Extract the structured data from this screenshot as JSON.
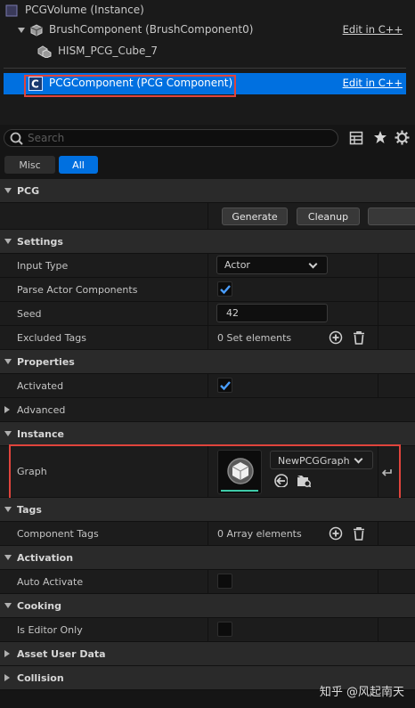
{
  "tree": {
    "items": [
      {
        "label": "PCGVolume (Instance)"
      },
      {
        "label": "BrushComponent (BrushComponent0)",
        "edit": "Edit in C++"
      },
      {
        "label": "HISM_PCG_Cube_7"
      },
      {
        "label": "PCGComponent (PCG Component)",
        "edit": "Edit in C++"
      }
    ]
  },
  "search": {
    "placeholder": "Search"
  },
  "filters": {
    "misc": "Misc",
    "all": "All"
  },
  "sections": {
    "pcg": "PCG",
    "settings": "Settings",
    "properties": "Properties",
    "instance": "Instance",
    "tags": "Tags",
    "activation": "Activation",
    "cooking": "Cooking",
    "asset_user_data": "Asset User Data",
    "collision": "Collision"
  },
  "pcg": {
    "generate": "Generate",
    "cleanup": "Cleanup"
  },
  "settings": {
    "input_type_label": "Input Type",
    "input_type_value": "Actor",
    "parse_label": "Parse Actor Components",
    "seed_label": "Seed",
    "seed_value": "42",
    "excluded_label": "Excluded Tags",
    "excluded_value": "0 Set elements"
  },
  "properties": {
    "activated_label": "Activated",
    "advanced_label": "Advanced"
  },
  "instance": {
    "graph_label": "Graph",
    "graph_value": "NewPCGGraph"
  },
  "tags": {
    "component_tags_label": "Component Tags",
    "component_tags_value": "0 Array elements"
  },
  "activation": {
    "auto_activate_label": "Auto Activate"
  },
  "cooking": {
    "editor_only_label": "Is Editor Only"
  },
  "watermark": "知乎 @风起南天",
  "colors": {
    "selection": "#0070e0",
    "highlight_box": "#e0443c",
    "checkbox_tick": "#4a9eff"
  }
}
